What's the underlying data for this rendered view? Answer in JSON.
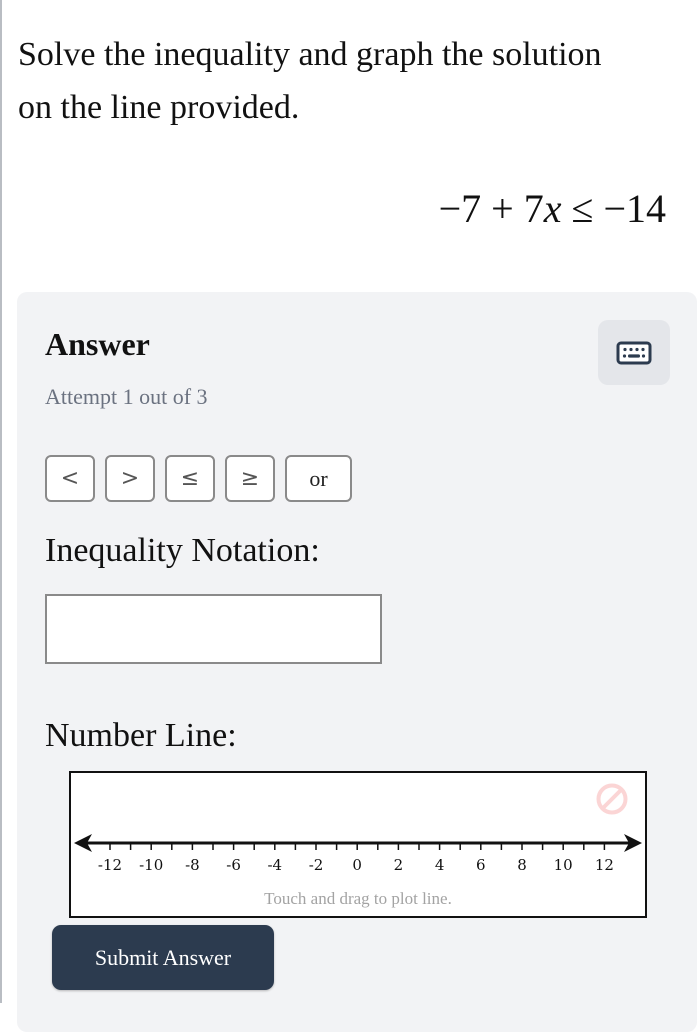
{
  "question": {
    "prompt": "Solve the inequality and graph the solution on the line provided.",
    "equation": {
      "left": "−7 + 7",
      "variable": "x",
      "operator": "≤",
      "right": "−14"
    }
  },
  "answer_panel": {
    "title": "Answer",
    "attempt_text": "Attempt 1 out of 3",
    "keyboard_icon": "keyboard-icon",
    "symbol_buttons": [
      {
        "label": "<",
        "name": "less-than"
      },
      {
        "label": ">",
        "name": "greater-than"
      },
      {
        "label": "≤",
        "name": "less-equal"
      },
      {
        "label": "≥",
        "name": "greater-equal"
      },
      {
        "label": "or",
        "name": "or"
      }
    ],
    "inequality_label": "Inequality Notation:",
    "inequality_value": "",
    "number_line_label": "Number Line:",
    "number_line": {
      "min": -13,
      "max": 13,
      "tick_step": 1,
      "label_values": [
        -12,
        -10,
        -8,
        -6,
        -4,
        -2,
        0,
        2,
        4,
        6,
        8,
        10,
        12
      ],
      "hint": "Touch and drag to plot line.",
      "clear_icon": "prohibit-icon",
      "clear_icon_color": "#fbd5d5"
    },
    "submit_label": "Submit Answer"
  },
  "colors": {
    "panel_bg": "#f2f3f5",
    "submit_bg": "#2c3b4f",
    "keyboard_btn_bg": "#e4e6ea"
  }
}
